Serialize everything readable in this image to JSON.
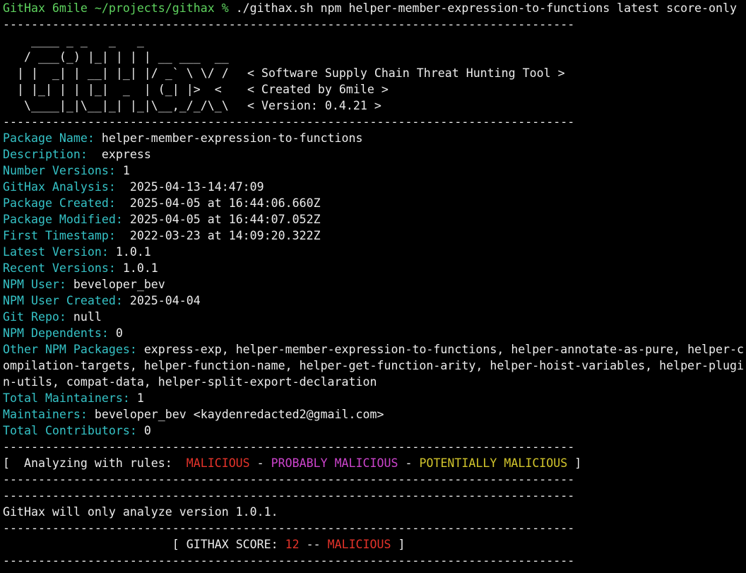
{
  "colors": {
    "prompt": "#5ed25e",
    "label": "#35c2c6",
    "text": "#ececec",
    "malicious": "#e5332a",
    "probably_malicious": "#cc44cc",
    "potentially_malicious": "#d2c52c",
    "background": "#000000"
  },
  "prompt": {
    "host": "GitHax 6mile ~/projects/githax %",
    "command": " ./githax.sh npm helper-member-expression-to-functions latest score-only"
  },
  "separator": "---------------------------------------------------------------------------------",
  "banner": {
    "art": [
      "    ____ _ _   _   _",
      "   / ___(_) |_| | | | __ ___  __",
      "  | |  _| | __| |_| |/ _` \\ \\/ /",
      "  | |_| | | |_|  _  | (_| |>  <",
      "   \\____|_|\\__|_| |_|\\__,_/_/\\_\\"
    ],
    "tags": [
      "",
      "",
      "< Software Supply Chain Threat Hunting Tool >",
      "< Created by 6mile >",
      "< Version: 0.4.21 >"
    ]
  },
  "info": [
    {
      "label": "Package Name:",
      "value": " helper-member-expression-to-functions"
    },
    {
      "label": "Description:",
      "value": "  express"
    },
    {
      "label": "Number Versions:",
      "value": " 1"
    },
    {
      "label": "GitHax Analysis:",
      "value": "  2025-04-13-14:47:09"
    },
    {
      "label": "Package Created:",
      "value": "  2025-04-05 at 16:44:06.660Z"
    },
    {
      "label": "Package Modified:",
      "value": " 2025-04-05 at 16:44:07.052Z"
    },
    {
      "label": "First Timestamp:",
      "value": "  2022-03-23 at 14:09:20.322Z"
    },
    {
      "label": "Latest Version:",
      "value": " 1.0.1"
    },
    {
      "label": "Recent Versions:",
      "value": " 1.0.1"
    },
    {
      "label": "NPM User:",
      "value": " beveloper_bev"
    },
    {
      "label": "NPM User Created:",
      "value": " 2025-04-04"
    },
    {
      "label": "Git Repo:",
      "value": " null"
    },
    {
      "label": "NPM Dependents:",
      "value": " 0"
    }
  ],
  "other_packages": {
    "label": "Other NPM Packages:",
    "value": " express-exp, helper-member-expression-to-functions, helper-annotate-as-pure, helper-compilation-targets, helper-function-name, helper-get-function-arity, helper-hoist-variables, helper-plugin-utils, compat-data, helper-split-export-declaration"
  },
  "info2": [
    {
      "label": "Total Maintainers:",
      "value": " 1"
    },
    {
      "label": "Maintainers:",
      "value": " beveloper_bev <kaydenredacted2@gmail.com>"
    },
    {
      "label": "Total Contributors:",
      "value": " 0"
    }
  ],
  "rules": {
    "prefix": "[  Analyzing with rules:  ",
    "malicious": "MALICIOUS",
    "dash1": " - ",
    "probably": "PROBABLY MALICIOUS",
    "dash2": " - ",
    "potentially": "POTENTIALLY MALICIOUS",
    "suffix": " ]"
  },
  "analyze_note": "GitHax will only analyze version 1.0.1.",
  "score": {
    "indent": "                        ",
    "prefix": "[ GITHAX SCORE: ",
    "value": "12",
    "middle": " -- ",
    "verdict": "MALICIOUS",
    "suffix": " ]"
  }
}
